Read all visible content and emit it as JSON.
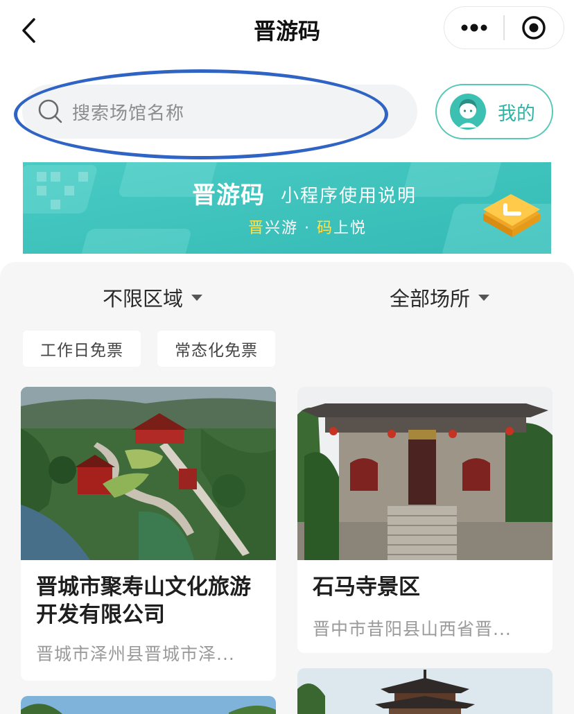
{
  "header": {
    "title": "晋游码"
  },
  "icons": {
    "back": "chevron-left-icon",
    "more": "more-dots-icon",
    "close": "target-close-icon",
    "search": "search-icon",
    "avatar": "avatar-icon",
    "banner_button": "banner-button-icon"
  },
  "search": {
    "placeholder": "搜索场馆名称"
  },
  "mine": {
    "label": "我的"
  },
  "banner": {
    "title": "晋游码",
    "subtitle": "小程序使用说明",
    "tag_1": "晋",
    "tag_2": "兴游 · ",
    "tag_3": "码",
    "tag_4": "上悦"
  },
  "filters": {
    "region": "不限区域",
    "venue": "全部场所"
  },
  "chips": [
    "工作日免票",
    "常态化免票"
  ],
  "venues": [
    {
      "name_line1": "晋城市聚寿山文化旅游",
      "name_line2": "开发有限公司",
      "address": "晋城市泽州县晋城市泽..."
    },
    {
      "name_line1": "石马寺景区",
      "address": "晋中市昔阳县山西省晋..."
    }
  ],
  "colors": {
    "accent_teal": "#2fb3a4",
    "highlight_blue": "#2f63c4",
    "banner_teal": "#3fc4bd",
    "banner_yellow": "#ffe14a"
  }
}
